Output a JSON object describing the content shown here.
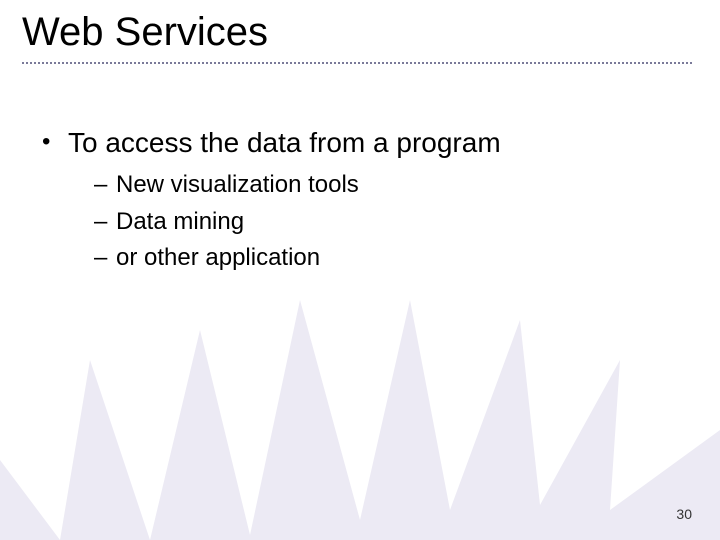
{
  "title": "Web Services",
  "bullets": [
    {
      "text": "To access the data from a program",
      "sub": [
        "New visualization tools",
        "Data mining",
        "or other application"
      ]
    }
  ],
  "page_number": "30",
  "colors": {
    "background_shape": "#eceaf4",
    "underline": "#7a7a99",
    "text": "#000000"
  }
}
